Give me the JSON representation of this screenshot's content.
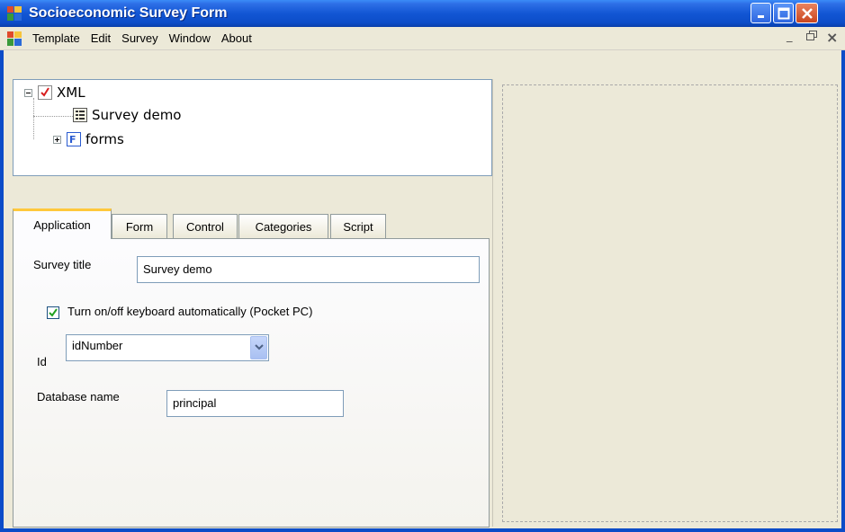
{
  "window": {
    "title": "Socioeconomic Survey Form"
  },
  "menu": {
    "items": [
      "Template",
      "Edit",
      "Survey",
      "Window",
      "About"
    ],
    "mdi_minimize": "_",
    "mdi_restore": "▫",
    "mdi_close": "×"
  },
  "tree": {
    "root": "XML",
    "children": [
      "Survey demo",
      "forms"
    ]
  },
  "tabs": [
    "Application",
    "Form",
    "Control",
    "Categories",
    "Script"
  ],
  "application_tab": {
    "survey_title_label": "Survey title",
    "survey_title_value": "Survey demo",
    "keyboard_checkbox_label": "Turn on/off keyboard automatically (Pocket PC)",
    "keyboard_checkbox_checked": true,
    "id_label": "Id",
    "id_value": "idNumber",
    "database_name_label": "Database name",
    "database_name_value": "principal"
  }
}
